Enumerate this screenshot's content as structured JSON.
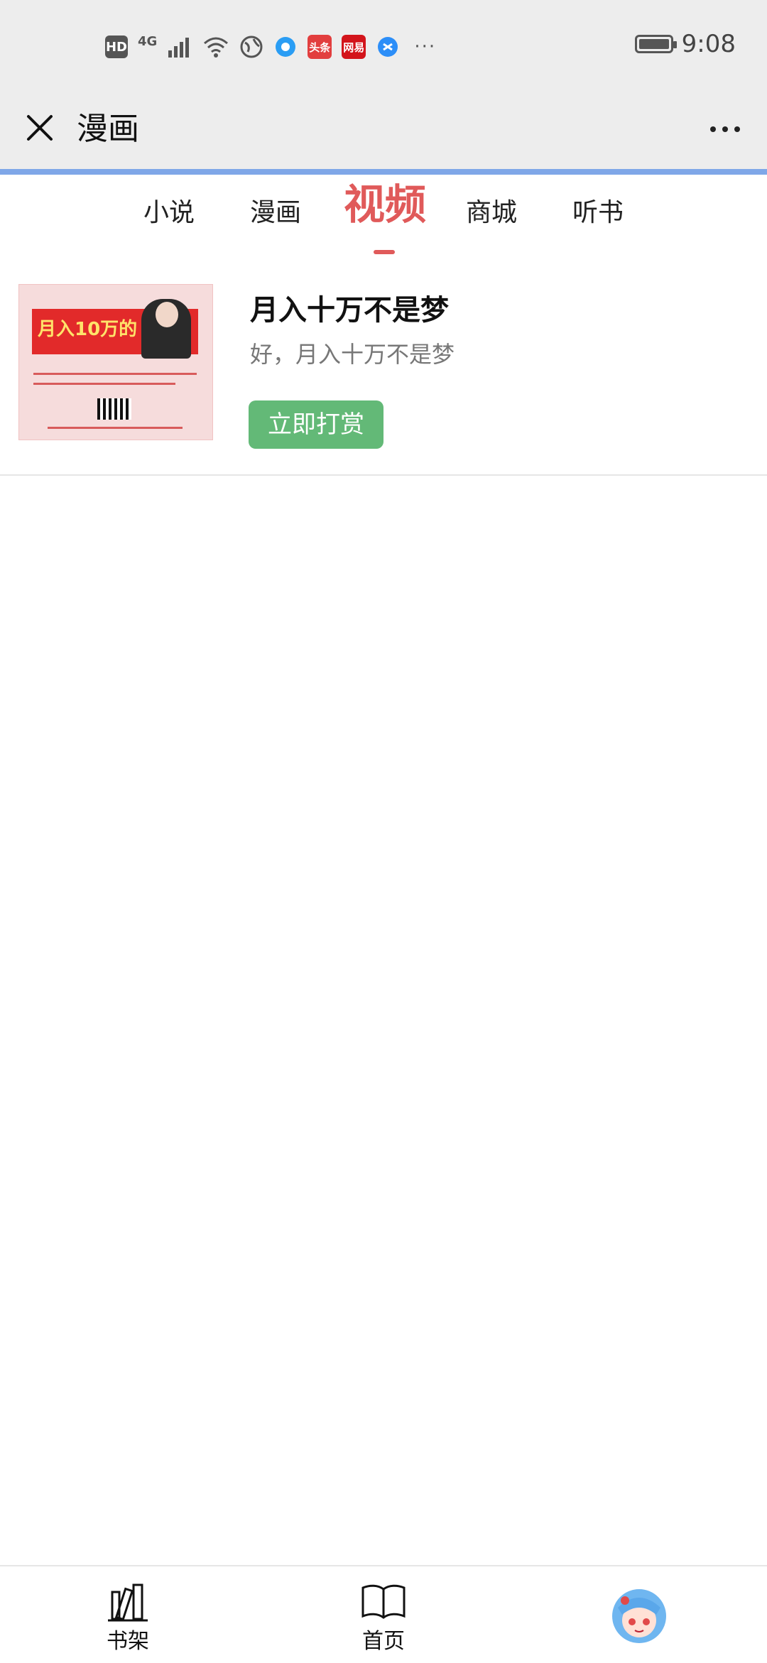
{
  "status_bar": {
    "network": "4G",
    "hd": "HD",
    "app_icons": [
      {
        "name": "toutiao",
        "label": "头条",
        "color": "#e23e3e"
      },
      {
        "name": "netease",
        "label": "网易",
        "color": "#d3141b"
      }
    ],
    "time": "9:08"
  },
  "header": {
    "title": "漫画"
  },
  "tabs": [
    {
      "label": "小说",
      "active": false
    },
    {
      "label": "漫画",
      "active": false
    },
    {
      "label": "视频",
      "active": true
    },
    {
      "label": "商城",
      "active": false
    },
    {
      "label": "听书",
      "active": false
    }
  ],
  "item": {
    "title": "月入十万不是梦",
    "desc": "好，月入十万不是梦",
    "button": "立即打赏",
    "thumbnail": {
      "banner_text": "月入10万的"
    }
  },
  "bottom_nav": [
    {
      "label": "书架",
      "icon": "bookshelf-icon"
    },
    {
      "label": "首页",
      "icon": "book-icon"
    },
    {
      "label": "",
      "icon": "avatar-icon"
    }
  ],
  "colors": {
    "accent": "#e05a5a",
    "button": "#63b977",
    "header_bg": "#ededed",
    "progress": "#7fa7e8"
  }
}
